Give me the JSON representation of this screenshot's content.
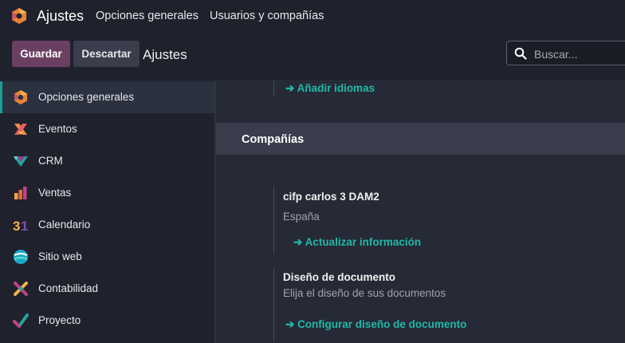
{
  "header": {
    "app_title": "Ajustes",
    "menu": [
      "Opciones generales",
      "Usuarios y compañías"
    ]
  },
  "control_panel": {
    "save_label": "Guardar",
    "discard_label": "Descartar",
    "breadcrumb": "Ajustes",
    "search_placeholder": "Buscar..."
  },
  "sidebar": {
    "items": [
      {
        "label": "Opciones generales",
        "icon": "settings-icon",
        "active": true
      },
      {
        "label": "Eventos",
        "icon": "events-icon"
      },
      {
        "label": "CRM",
        "icon": "crm-icon"
      },
      {
        "label": "Ventas",
        "icon": "sales-icon"
      },
      {
        "label": "Calendario",
        "icon": "calendar-icon"
      },
      {
        "label": "Sitio web",
        "icon": "website-icon"
      },
      {
        "label": "Contabilidad",
        "icon": "accounting-icon"
      },
      {
        "label": "Proyecto",
        "icon": "project-icon"
      }
    ]
  },
  "main": {
    "add_languages_link": "Añadir idiomas",
    "companies_section": {
      "title": "Compañías",
      "company_name": "cifp carlos 3 DAM2",
      "company_country": "España",
      "update_info_link": "Actualizar información",
      "doc_layout_title": "Diseño de documento",
      "doc_layout_desc": "Elija el diseño de sus documentos",
      "configure_layout_link": "Configurar diseño de documento"
    }
  },
  "colors": {
    "accent": "#21b8a8",
    "primary_button": "#6b3f62",
    "background": "#262a36",
    "navbar": "#1f222c"
  }
}
